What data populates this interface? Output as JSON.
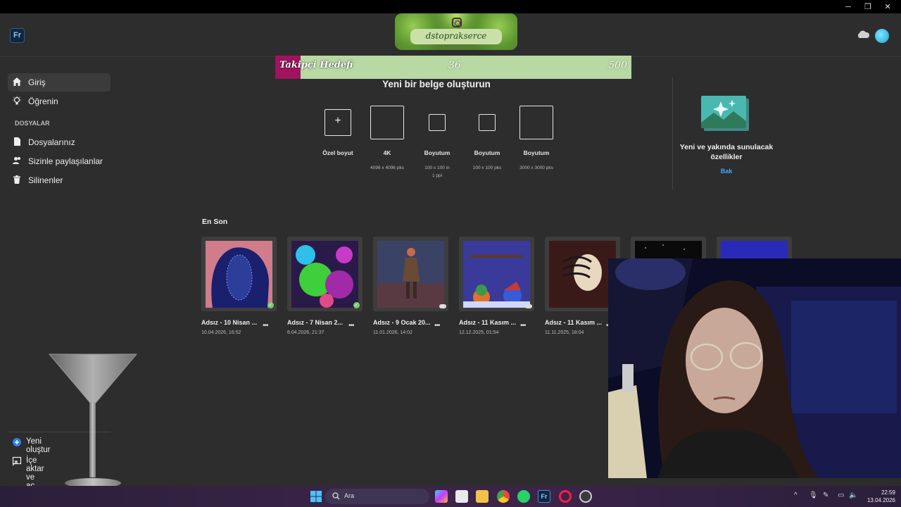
{
  "window": {
    "minimize": "─",
    "maximize": "❐",
    "close": "✕"
  },
  "header": {
    "app_logo": "Fr",
    "banner_handle": "dstoprakserce"
  },
  "goal": {
    "label": "Takipçi Hedefi",
    "current": 36,
    "target": 500,
    "progress_fraction": 0.072
  },
  "sidebar": {
    "items": [
      {
        "label": "Giriş",
        "icon": "home-icon"
      },
      {
        "label": "Öğrenin",
        "icon": "lightbulb-icon"
      }
    ],
    "section_label": "DOSYALAR",
    "file_items": [
      {
        "label": "Dosyalarınız",
        "icon": "file-icon"
      },
      {
        "label": "Sizinle paylaşılanlar",
        "icon": "shared-users-icon"
      },
      {
        "label": "Silinenler",
        "icon": "trash-icon"
      }
    ],
    "bottom": {
      "new_label": "Yeni oluştur",
      "import_label": "İçe aktar ve aç"
    }
  },
  "create": {
    "title": "Yeni bir belge oluşturun",
    "presets": [
      {
        "name": "Özel boyut",
        "dim": ""
      },
      {
        "name": "4K",
        "dim": "4096 x 4096 pks"
      },
      {
        "name": "Boyutum",
        "dim": "100 x 100 in 1 ppi"
      },
      {
        "name": "Boyutum",
        "dim": "100 x 100 pks"
      },
      {
        "name": "Boyutum",
        "dim": "3000 x 3000 pks"
      }
    ]
  },
  "whats_new": {
    "title_line1": "Yeni ve yakında sunulacak",
    "title_line2": "özellikler",
    "link": "Bak"
  },
  "recent": {
    "title": "En Son",
    "more": "•••",
    "files": [
      {
        "name": "Adsız - 10 Nisan ...",
        "date": "10.04.2026, 16:52",
        "status": "synced"
      },
      {
        "name": "Adsız - 7 Nisan 2...",
        "date": "8.04.2026, 21:37",
        "status": "synced"
      },
      {
        "name": "Adsız - 9 Ocak 20...",
        "date": "11.01.2026, 14:02",
        "status": "cloud"
      },
      {
        "name": "Adsız - 11 Kasım ...",
        "date": "12.12.2025, 01:54",
        "status": "cloud"
      },
      {
        "name": "Adsız - 11 Kasım ...",
        "date": "11.11.2025, 18:04",
        "status": "cloud"
      }
    ]
  },
  "taskbar": {
    "search_placeholder": "Ara",
    "time": "22:59",
    "date": "13.04.2026"
  },
  "colors": {
    "accent": "#a0135e",
    "goal_bg": "#b9d9a4",
    "link": "#4aa3ff"
  }
}
